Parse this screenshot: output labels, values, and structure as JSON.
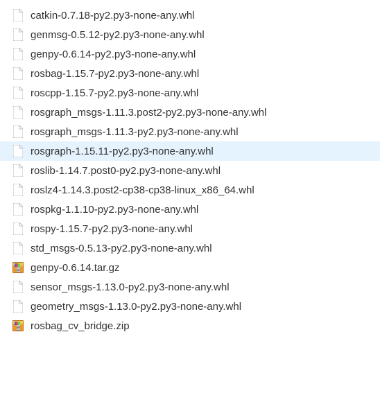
{
  "files": [
    {
      "name": "catkin-0.7.18-py2.py3-none-any.whl",
      "icon": "doc",
      "selected": false
    },
    {
      "name": "genmsg-0.5.12-py2.py3-none-any.whl",
      "icon": "doc",
      "selected": false
    },
    {
      "name": "genpy-0.6.14-py2.py3-none-any.whl",
      "icon": "doc",
      "selected": false
    },
    {
      "name": "rosbag-1.15.7-py2.py3-none-any.whl",
      "icon": "doc",
      "selected": false
    },
    {
      "name": "roscpp-1.15.7-py2.py3-none-any.whl",
      "icon": "doc",
      "selected": false
    },
    {
      "name": "rosgraph_msgs-1.11.3.post2-py2.py3-none-any.whl",
      "icon": "doc",
      "selected": false
    },
    {
      "name": "rosgraph_msgs-1.11.3-py2.py3-none-any.whl",
      "icon": "doc",
      "selected": false
    },
    {
      "name": "rosgraph-1.15.11-py2.py3-none-any.whl",
      "icon": "doc",
      "selected": true
    },
    {
      "name": "roslib-1.14.7.post0-py2.py3-none-any.whl",
      "icon": "doc",
      "selected": false
    },
    {
      "name": "roslz4-1.14.3.post2-cp38-cp38-linux_x86_64.whl",
      "icon": "doc",
      "selected": false
    },
    {
      "name": "rospkg-1.1.10-py2.py3-none-any.whl",
      "icon": "doc",
      "selected": false
    },
    {
      "name": "rospy-1.15.7-py2.py3-none-any.whl",
      "icon": "doc",
      "selected": false
    },
    {
      "name": "std_msgs-0.5.13-py2.py3-none-any.whl",
      "icon": "doc",
      "selected": false
    },
    {
      "name": "genpy-0.6.14.tar.gz",
      "icon": "archive",
      "selected": false
    },
    {
      "name": "sensor_msgs-1.13.0-py2.py3-none-any.whl",
      "icon": "doc",
      "selected": false
    },
    {
      "name": "geometry_msgs-1.13.0-py2.py3-none-any.whl",
      "icon": "doc",
      "selected": false
    },
    {
      "name": "rosbag_cv_bridge.zip",
      "icon": "archive",
      "selected": false
    }
  ]
}
